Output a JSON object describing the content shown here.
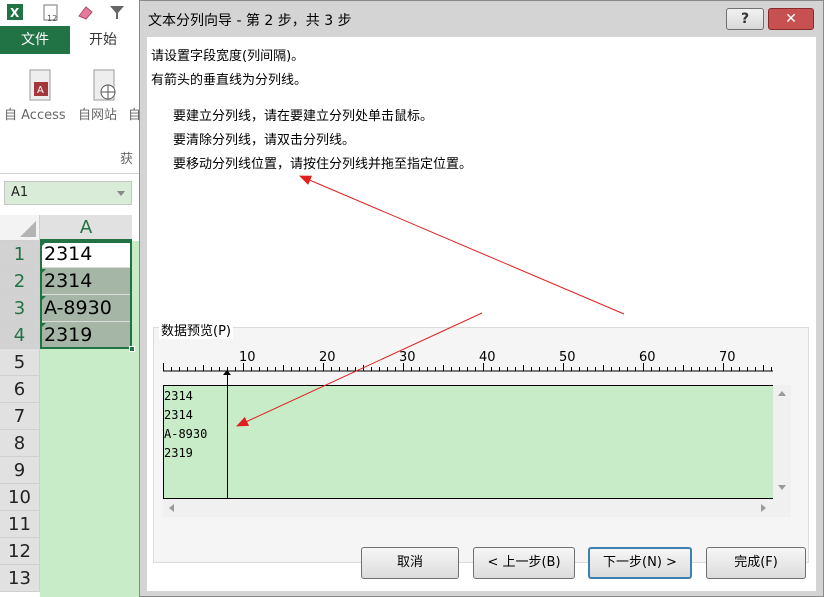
{
  "colors": {
    "excel_green": "#217346",
    "preview_bg": "#c8ebc8",
    "annotation_arrow": "#e02020",
    "close_button": "#c75050"
  },
  "excel": {
    "tabs": {
      "file": "文件",
      "home": "开始"
    },
    "ribbon": {
      "from_access": "自 Access",
      "from_web": "自网站",
      "from_cut": "自",
      "group_label_partial": "获"
    },
    "name_box": "A1",
    "column_header": "A",
    "rows": [
      {
        "num": "1",
        "value": "2314"
      },
      {
        "num": "2",
        "value": "2314"
      },
      {
        "num": "3",
        "value": "A-8930"
      },
      {
        "num": "4",
        "value": "2319"
      },
      {
        "num": "5",
        "value": ""
      },
      {
        "num": "6",
        "value": ""
      },
      {
        "num": "7",
        "value": ""
      },
      {
        "num": "8",
        "value": ""
      },
      {
        "num": "9",
        "value": ""
      },
      {
        "num": "10",
        "value": ""
      },
      {
        "num": "11",
        "value": ""
      },
      {
        "num": "12",
        "value": ""
      },
      {
        "num": "13",
        "value": ""
      }
    ]
  },
  "dialog": {
    "title": "文本分列向导 - 第 2 步，共 3 步",
    "help_icon": "?",
    "close_icon": "✕",
    "intro_line1": "请设置字段宽度(列间隔)。",
    "intro_line2": "有箭头的垂直线为分列线。",
    "instructions": [
      "要建立分列线，请在要建立分列处单击鼠标。",
      "要清除分列线，请双击分列线。",
      "要移动分列线位置，请按住分列线并拖至指定位置。"
    ],
    "preview_label": "数据预览(P)",
    "ruler_labels": [
      "10",
      "20",
      "30",
      "40",
      "50",
      "60",
      "70"
    ],
    "preview_lines": [
      "2314",
      "2314",
      "A-8930",
      "2319"
    ],
    "buttons": {
      "cancel": "取消",
      "back": "< 上一步(B)",
      "next": "下一步(N) >",
      "finish": "完成(F)"
    }
  }
}
